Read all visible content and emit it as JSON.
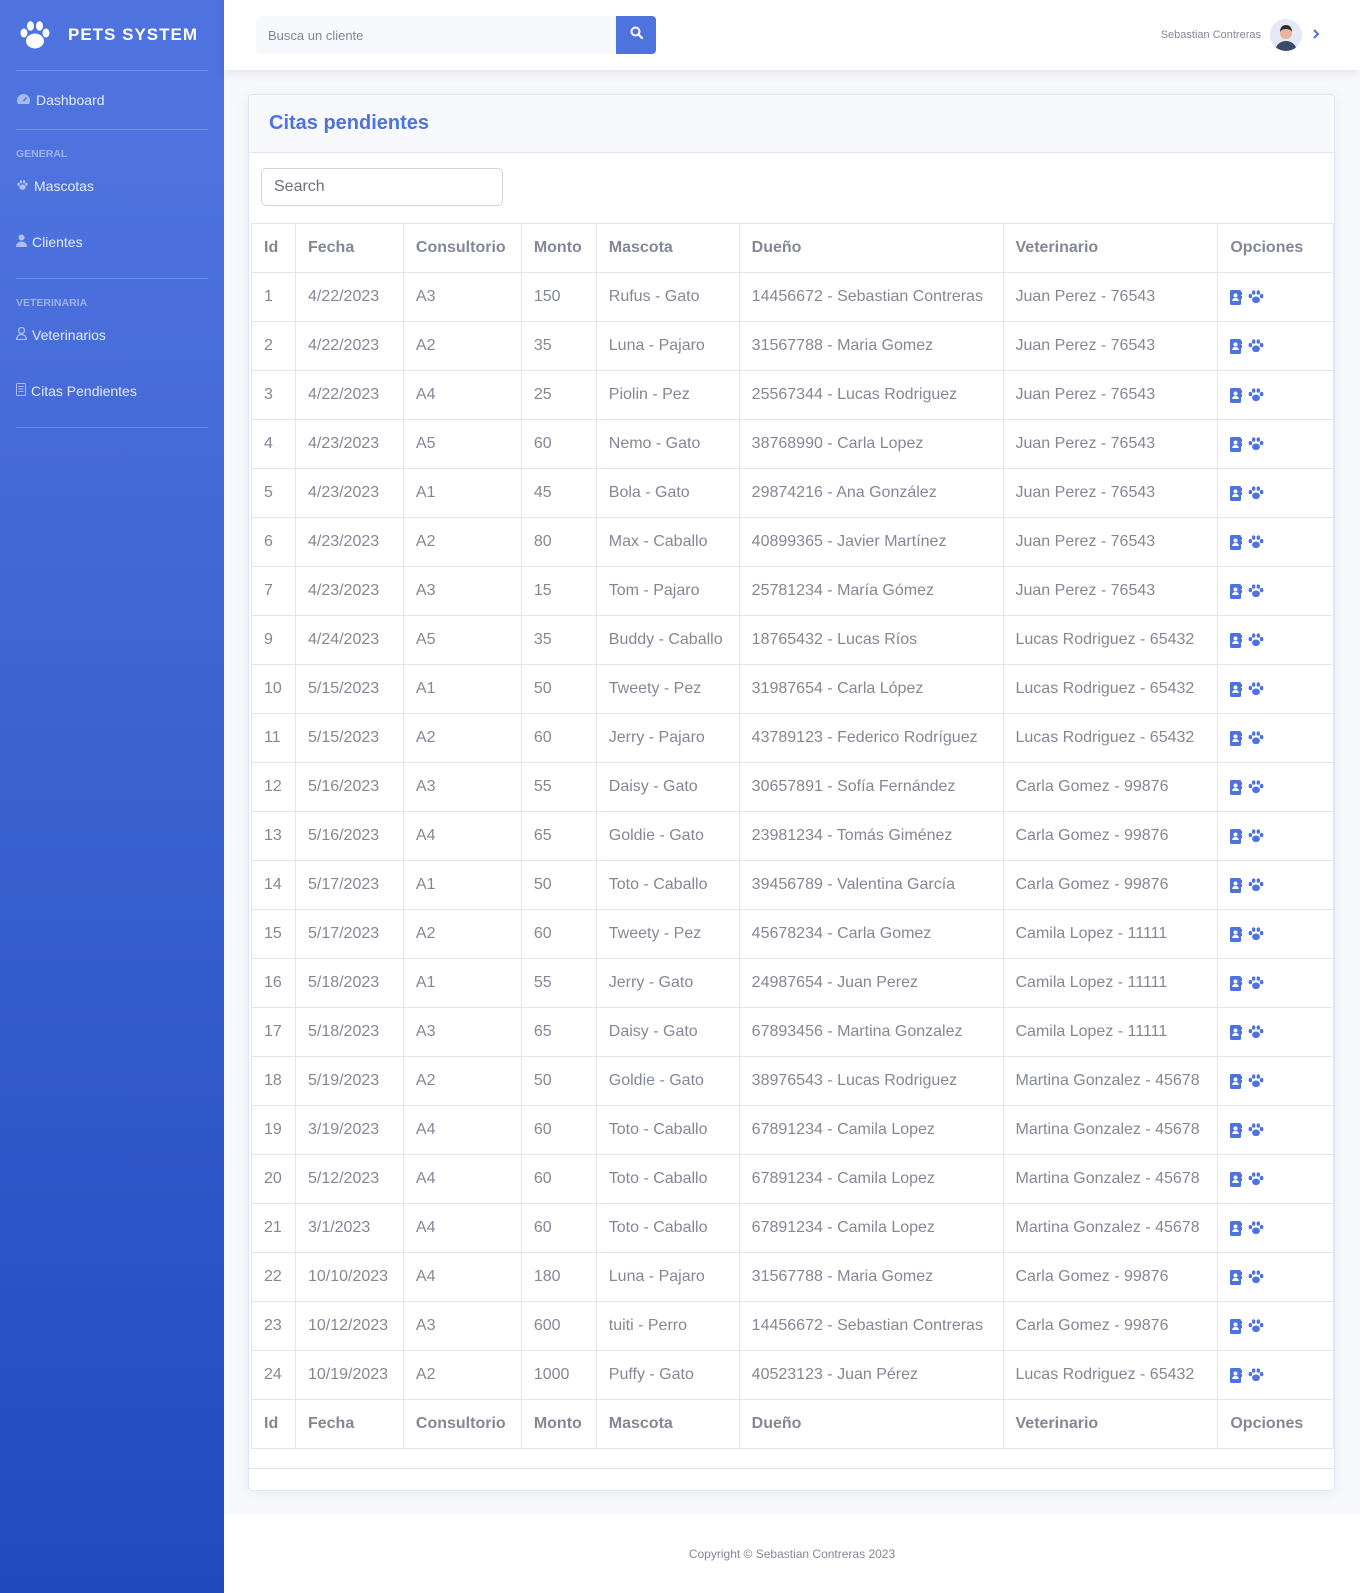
{
  "brand": {
    "name": "PETS SYSTEM",
    "icon": "paw-icon"
  },
  "sidebar": {
    "dashboard": {
      "label": "Dashboard",
      "icon": "tachometer-icon"
    },
    "heading_general": "GENERAL",
    "mascotas": {
      "label": "Mascotas",
      "icon": "paw-icon"
    },
    "clientes": {
      "label": "Clientes",
      "icon": "user-icon"
    },
    "heading_veterinaria": "VETERINARIA",
    "veterinarios": {
      "label": "Veterinarios",
      "icon": "user-doctor-icon"
    },
    "citas": {
      "label": "Citas Pendientes",
      "icon": "list-icon"
    }
  },
  "topbar": {
    "search_placeholder": "Busca un cliente",
    "user_name": "Sebastian Contreras"
  },
  "card": {
    "title": "Citas pendientes",
    "search_placeholder": "Search"
  },
  "table": {
    "headers": [
      "Id",
      "Fecha",
      "Consultorio",
      "Monto",
      "Mascota",
      "Dueño",
      "Veterinario",
      "Opciones"
    ],
    "rows": [
      [
        "1",
        "4/22/2023",
        "A3",
        "150",
        "Rufus - Gato",
        "14456672 - Sebastian Contreras",
        "Juan Perez - 76543"
      ],
      [
        "2",
        "4/22/2023",
        "A2",
        "35",
        "Luna - Pajaro",
        "31567788 - Maria Gomez",
        "Juan Perez - 76543"
      ],
      [
        "3",
        "4/22/2023",
        "A4",
        "25",
        "Piolin - Pez",
        "25567344 - Lucas Rodriguez",
        "Juan Perez - 76543"
      ],
      [
        "4",
        "4/23/2023",
        "A5",
        "60",
        "Nemo - Gato",
        "38768990 - Carla Lopez",
        "Juan Perez - 76543"
      ],
      [
        "5",
        "4/23/2023",
        "A1",
        "45",
        "Bola - Gato",
        "29874216 - Ana González",
        "Juan Perez - 76543"
      ],
      [
        "6",
        "4/23/2023",
        "A2",
        "80",
        "Max - Caballo",
        "40899365 - Javier Martínez",
        "Juan Perez - 76543"
      ],
      [
        "7",
        "4/23/2023",
        "A3",
        "15",
        "Tom - Pajaro",
        "25781234 - María Gómez",
        "Juan Perez - 76543"
      ],
      [
        "9",
        "4/24/2023",
        "A5",
        "35",
        "Buddy - Caballo",
        "18765432 - Lucas Ríos",
        "Lucas Rodriguez - 65432"
      ],
      [
        "10",
        "5/15/2023",
        "A1",
        "50",
        "Tweety - Pez",
        "31987654 - Carla López",
        "Lucas Rodriguez - 65432"
      ],
      [
        "11",
        "5/15/2023",
        "A2",
        "60",
        "Jerry - Pajaro",
        "43789123 - Federico Rodríguez",
        "Lucas Rodriguez - 65432"
      ],
      [
        "12",
        "5/16/2023",
        "A3",
        "55",
        "Daisy - Gato",
        "30657891 - Sofía Fernández",
        "Carla Gomez - 99876"
      ],
      [
        "13",
        "5/16/2023",
        "A4",
        "65",
        "Goldie - Gato",
        "23981234 - Tomás Giménez",
        "Carla Gomez - 99876"
      ],
      [
        "14",
        "5/17/2023",
        "A1",
        "50",
        "Toto - Caballo",
        "39456789 - Valentina García",
        "Carla Gomez - 99876"
      ],
      [
        "15",
        "5/17/2023",
        "A2",
        "60",
        "Tweety - Pez",
        "45678234 - Carla Gomez",
        "Camila Lopez - 11111"
      ],
      [
        "16",
        "5/18/2023",
        "A1",
        "55",
        "Jerry - Gato",
        "24987654 - Juan Perez",
        "Camila Lopez - 11111"
      ],
      [
        "17",
        "5/18/2023",
        "A3",
        "65",
        "Daisy - Gato",
        "67893456 - Martina Gonzalez",
        "Camila Lopez - 11111"
      ],
      [
        "18",
        "5/19/2023",
        "A2",
        "50",
        "Goldie - Gato",
        "38976543 - Lucas Rodriguez",
        "Martina Gonzalez - 45678"
      ],
      [
        "19",
        "3/19/2023",
        "A4",
        "60",
        "Toto - Caballo",
        "67891234 - Camila Lopez",
        "Martina Gonzalez - 45678"
      ],
      [
        "20",
        "5/12/2023",
        "A4",
        "60",
        "Toto - Caballo",
        "67891234 - Camila Lopez",
        "Martina Gonzalez - 45678"
      ],
      [
        "21",
        "3/1/2023",
        "A4",
        "60",
        "Toto - Caballo",
        "67891234 - Camila Lopez",
        "Martina Gonzalez - 45678"
      ],
      [
        "22",
        "10/10/2023",
        "A4",
        "180",
        "Luna - Pajaro",
        "31567788 - Maria Gomez",
        "Carla Gomez - 99876"
      ],
      [
        "23",
        "10/12/2023",
        "A3",
        "600",
        "tuiti - Perro",
        "14456672 - Sebastian Contreras",
        "Carla Gomez - 99876"
      ],
      [
        "24",
        "10/19/2023",
        "A2",
        "1000",
        "Puffy - Gato",
        "40523123 - Juan Pérez",
        "Lucas Rodriguez - 65432"
      ]
    ],
    "option_icons": [
      "address-book-icon",
      "paw-icon"
    ]
  },
  "footer": {
    "text": "Copyright © Sebastian Contreras 2023"
  },
  "colors": {
    "primary": "#4e73df",
    "primary_dark": "#224abe",
    "text_muted": "#858796"
  }
}
